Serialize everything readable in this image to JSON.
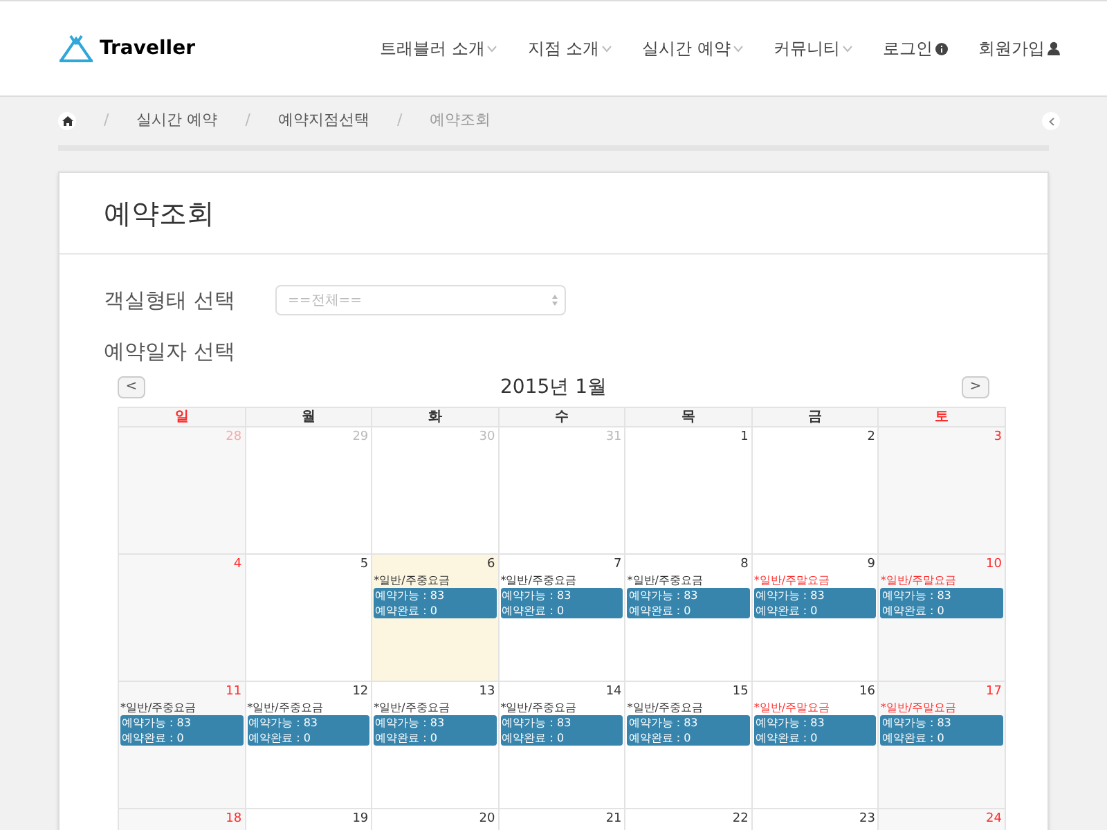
{
  "logo": {
    "text": "Traveller"
  },
  "nav": [
    {
      "label": "트래블러 소개",
      "kind": "dropdown"
    },
    {
      "label": "지점 소개",
      "kind": "dropdown"
    },
    {
      "label": "실시간 예약",
      "kind": "dropdown"
    },
    {
      "label": "커뮤니티",
      "kind": "dropdown"
    },
    {
      "label": "로그인",
      "kind": "login"
    },
    {
      "label": "회원가입",
      "kind": "user"
    }
  ],
  "breadcrumb": [
    {
      "kind": "home"
    },
    {
      "kind": "separator",
      "text": "/"
    },
    {
      "kind": "link",
      "text": "실시간 예약"
    },
    {
      "kind": "separator",
      "text": "/"
    },
    {
      "kind": "link",
      "text": "예약지점선택"
    },
    {
      "kind": "separator",
      "text": "/"
    },
    {
      "kind": "current",
      "text": "예약조회"
    }
  ],
  "page_title": "예약조회",
  "room_type": {
    "label": "객실형태 선택",
    "placeholder": "==전체=="
  },
  "date_label": "예약일자 선택",
  "calendar": {
    "title": "2015년 1월",
    "prev": "<",
    "next": ">",
    "weekdays": [
      {
        "label": "일",
        "red": true
      },
      {
        "label": "월",
        "red": false
      },
      {
        "label": "화",
        "red": false
      },
      {
        "label": "수",
        "red": false
      },
      {
        "label": "목",
        "red": false
      },
      {
        "label": "금",
        "red": false
      },
      {
        "label": "토",
        "red": true
      }
    ],
    "weeks": [
      [
        {
          "date": "28",
          "other_month": true,
          "today": false
        },
        {
          "date": "29",
          "other_month": true,
          "today": false
        },
        {
          "date": "30",
          "other_month": true,
          "today": false
        },
        {
          "date": "31",
          "other_month": true,
          "today": false
        },
        {
          "date": "1",
          "other_month": false,
          "today": false
        },
        {
          "date": "2",
          "other_month": false,
          "today": false
        },
        {
          "date": "3",
          "other_month": false,
          "today": false
        }
      ],
      [
        {
          "date": "4",
          "other_month": false,
          "today": false
        },
        {
          "date": "5",
          "other_month": false,
          "today": false
        },
        {
          "date": "6",
          "other_month": false,
          "today": true,
          "event": {
            "kind": "weekday",
            "rate": "*일반/주중요금",
            "lines": [
              "예약가능 : 83",
              "예약완료 : 0"
            ]
          }
        },
        {
          "date": "7",
          "other_month": false,
          "today": false,
          "event": {
            "kind": "weekday",
            "rate": "*일반/주중요금",
            "lines": [
              "예약가능 : 83",
              "예약완료 : 0"
            ]
          }
        },
        {
          "date": "8",
          "other_month": false,
          "today": false,
          "event": {
            "kind": "weekday",
            "rate": "*일반/주중요금",
            "lines": [
              "예약가능 : 83",
              "예약완료 : 0"
            ]
          }
        },
        {
          "date": "9",
          "other_month": false,
          "today": false,
          "event": {
            "kind": "weekend",
            "rate": "*일반/주말요금",
            "lines": [
              "예약가능 : 83",
              "예약완료 : 0"
            ]
          }
        },
        {
          "date": "10",
          "other_month": false,
          "today": false,
          "event": {
            "kind": "weekend",
            "rate": "*일반/주말요금",
            "lines": [
              "예약가능 : 83",
              "예약완료 : 0"
            ]
          }
        }
      ],
      [
        {
          "date": "11",
          "other_month": false,
          "today": false,
          "event": {
            "kind": "weekday",
            "rate": "*일반/주중요금",
            "lines": [
              "예약가능 : 83",
              "예약완료 : 0"
            ]
          }
        },
        {
          "date": "12",
          "other_month": false,
          "today": false,
          "event": {
            "kind": "weekday",
            "rate": "*일반/주중요금",
            "lines": [
              "예약가능 : 83",
              "예약완료 : 0"
            ]
          }
        },
        {
          "date": "13",
          "other_month": false,
          "today": false,
          "event": {
            "kind": "weekday",
            "rate": "*일반/주중요금",
            "lines": [
              "예약가능 : 83",
              "예약완료 : 0"
            ]
          }
        },
        {
          "date": "14",
          "other_month": false,
          "today": false,
          "event": {
            "kind": "weekday",
            "rate": "*일반/주중요금",
            "lines": [
              "예약가능 : 83",
              "예약완료 : 0"
            ]
          }
        },
        {
          "date": "15",
          "other_month": false,
          "today": false,
          "event": {
            "kind": "weekday",
            "rate": "*일반/주중요금",
            "lines": [
              "예약가능 : 83",
              "예약완료 : 0"
            ]
          }
        },
        {
          "date": "16",
          "other_month": false,
          "today": false,
          "event": {
            "kind": "weekend",
            "rate": "*일반/주말요금",
            "lines": [
              "예약가능 : 83",
              "예약완료 : 0"
            ]
          }
        },
        {
          "date": "17",
          "other_month": false,
          "today": false,
          "event": {
            "kind": "weekend",
            "rate": "*일반/주말요금",
            "lines": [
              "예약가능 : 83",
              "예약완료 : 0"
            ]
          }
        }
      ],
      [
        {
          "date": "18",
          "other_month": false,
          "today": false
        },
        {
          "date": "19",
          "other_month": false,
          "today": false
        },
        {
          "date": "20",
          "other_month": false,
          "today": false
        },
        {
          "date": "21",
          "other_month": false,
          "today": false
        },
        {
          "date": "22",
          "other_month": false,
          "today": false
        },
        {
          "date": "23",
          "other_month": false,
          "today": false
        },
        {
          "date": "24",
          "other_month": false,
          "today": false
        }
      ]
    ]
  }
}
